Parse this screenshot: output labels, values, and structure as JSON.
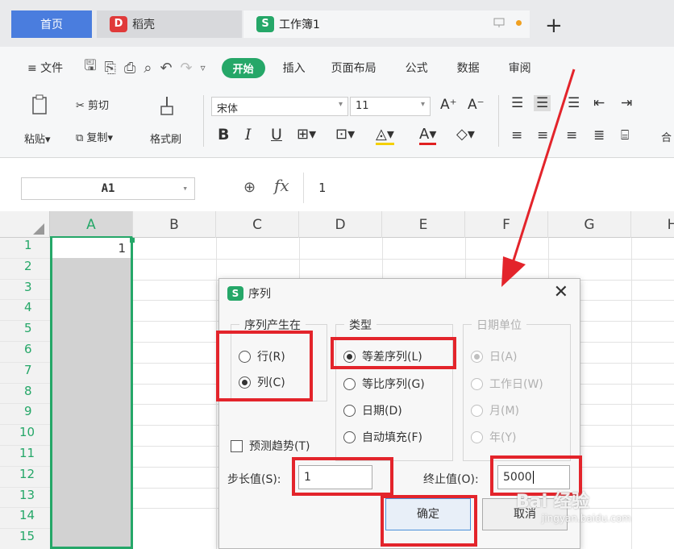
{
  "tabs": {
    "home": "首页",
    "daoke": "稻壳",
    "workbook": "工作簿1",
    "plus": "+"
  },
  "menu": {
    "file": "≡ 文件",
    "start": "开始",
    "insert": "插入",
    "layout": "页面布局",
    "formula": "公式",
    "data": "数据",
    "review": "审阅"
  },
  "ribbon": {
    "paste": "粘贴",
    "cut": "剪切",
    "copy": "复制",
    "format_painter": "格式刷",
    "font_name": "宋体",
    "font_size": "11",
    "merge": "合"
  },
  "formula_bar": {
    "name_box": "A1",
    "fx": "fx",
    "value": "1"
  },
  "grid": {
    "columns": [
      "A",
      "B",
      "C",
      "D",
      "E",
      "F",
      "G",
      "H"
    ],
    "rows": [
      "1",
      "2",
      "3",
      "4",
      "5",
      "6",
      "7",
      "8",
      "9",
      "10",
      "11",
      "12",
      "13",
      "14",
      "15"
    ],
    "cell_A1": "1"
  },
  "dialog": {
    "title": "序列",
    "series_in": {
      "title": "序列产生在",
      "row": "行(R)",
      "column": "列(C)",
      "selected": "column"
    },
    "type": {
      "title": "类型",
      "linear": "等差序列(L)",
      "growth": "等比序列(G)",
      "date": "日期(D)",
      "autofill": "自动填充(F)",
      "selected": "linear"
    },
    "date_unit": {
      "title": "日期单位",
      "day": "日(A)",
      "weekday": "工作日(W)",
      "month": "月(M)",
      "year": "年(Y)"
    },
    "trend": "预测趋势(T)",
    "step_label": "步长值(S):",
    "step_value": "1",
    "stop_label": "终止值(O):",
    "stop_value": "5000",
    "ok": "确定",
    "cancel": "取消"
  },
  "watermark": {
    "main": "Bai 经验",
    "sub": "jingyan.baidu.com"
  },
  "colors": {
    "accent_green": "#25a768",
    "tab_blue": "#4a7dde",
    "highlight_red": "#e3242b"
  }
}
